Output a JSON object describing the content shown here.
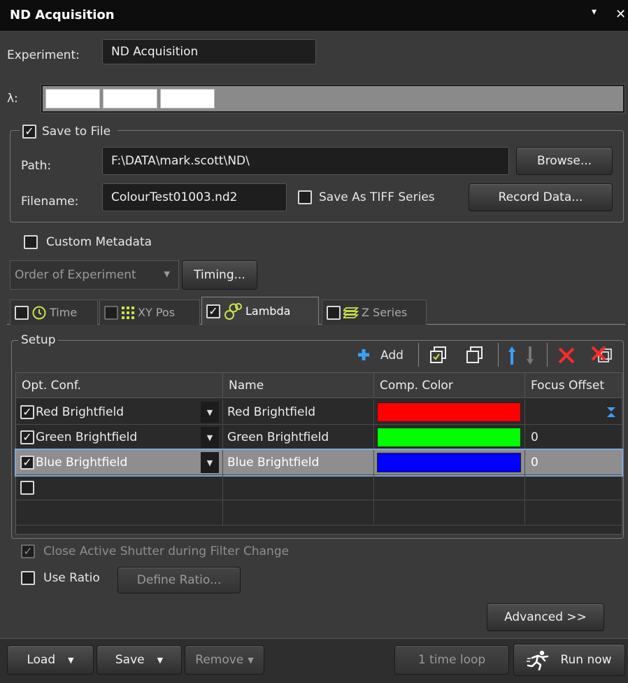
{
  "window": {
    "title": "ND Acquisition",
    "dropdown_glyph": "▾",
    "close_glyph": "✕"
  },
  "experiment": {
    "label": "Experiment:",
    "value": "ND Acquisition"
  },
  "lambda": {
    "label": "λ:"
  },
  "save_group": {
    "checkbox_label": "Save to File",
    "checked": true,
    "path_label": "Path:",
    "path_value": "F:\\DATA\\mark.scott\\ND\\",
    "browse_label": "Browse...",
    "filename_label": "Filename:",
    "filename_value": "ColourTest01003.nd2",
    "tiff_label": "Save As TIFF Series",
    "record_label": "Record Data..."
  },
  "custom_metadata": {
    "label": "Custom Metadata"
  },
  "order": {
    "label": "Order of Experiment",
    "timing_label": "Timing..."
  },
  "tabs": [
    {
      "label": "Time",
      "icon": "clock-icon",
      "checked": false
    },
    {
      "label": "XY Pos",
      "icon": "grid-dots-icon",
      "checked": false
    },
    {
      "label": "Lambda",
      "icon": "lambda-circles-icon",
      "checked": true
    },
    {
      "label": "Z Series",
      "icon": "z-stack-icon",
      "checked": false
    }
  ],
  "setup": {
    "label": "Setup",
    "add_label": "Add",
    "columns": [
      "Opt. Conf.",
      "Name",
      "Comp. Color",
      "Focus Offset"
    ],
    "rows": [
      {
        "opt": "Red Brightfield",
        "name": "Red Brightfield",
        "color": "#ff0000",
        "offset": ""
      },
      {
        "opt": "Green Brightfield",
        "name": "Green Brightfield",
        "color": "#00ff00",
        "offset": "0"
      },
      {
        "opt": "Blue Brightfield",
        "name": "Blue Brightfield",
        "color": "#0000ff",
        "offset": "0"
      }
    ]
  },
  "close_shutter_label": "Close Active Shutter during Filter Change",
  "use_ratio_label": "Use Ratio",
  "define_ratio_label": "Define Ratio...",
  "advanced_label": "Advanced >>",
  "footer": {
    "load_label": "Load",
    "save_label": "Save",
    "remove_label": "Remove",
    "loop_label": "1 time loop",
    "run_label": "Run now"
  }
}
